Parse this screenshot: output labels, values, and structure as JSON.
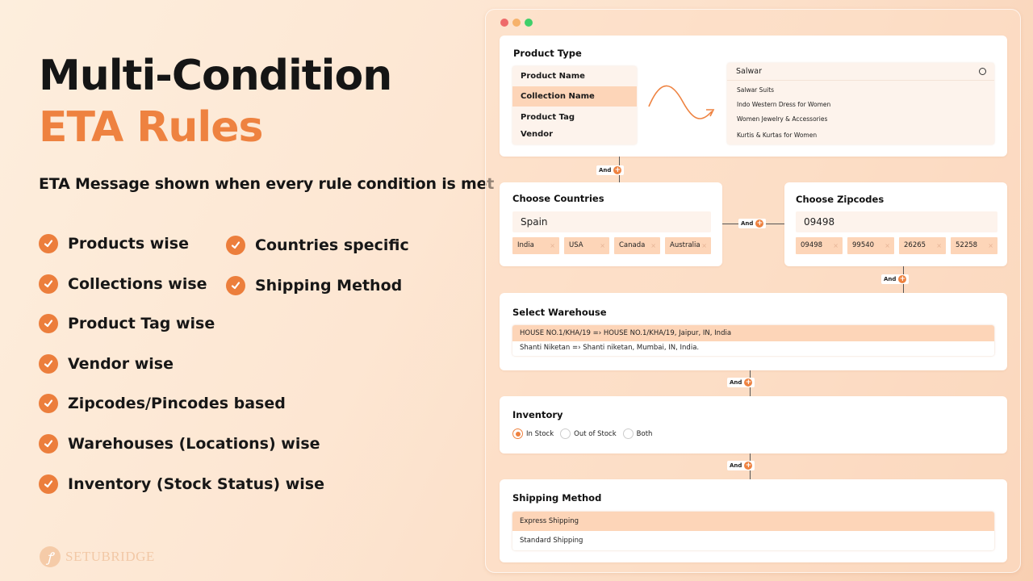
{
  "hero": {
    "title_line1": "Multi-Condition",
    "title_line2": "ETA Rules",
    "subtitle": "ETA Message shown when every rule condition is met",
    "features": [
      "Products wise",
      "Collections wise",
      "Product Tag wise",
      "Vendor wise",
      "Zipcodes/Pincodes based",
      "Warehouses (Locations) wise",
      "Inventory (Stock Status) wise",
      "Countries specific",
      "Shipping Method"
    ],
    "feature_icon": "check-circle-icon",
    "brand": "SETUBRIDGE"
  },
  "colors": {
    "accent": "#ee8240",
    "chip_bg": "#fdd5b8",
    "field_bg": "#fdf3ec"
  },
  "window": {
    "traffic_lights": [
      "#ee6a6a",
      "#f6b26b",
      "#3fcf6a"
    ],
    "connector_label": "And",
    "product_type": {
      "title": "Product Type",
      "options": [
        "Product Name",
        "Collection Name",
        "Product Tag",
        "Vendor"
      ],
      "selected": "Collection Name",
      "search_value": "Salwar",
      "suggestions": [
        "Salwar Suits",
        "Indo Western Dress for Women",
        "Women Jewelry & Accessories",
        "Kurtis & Kurtas for Women"
      ]
    },
    "countries": {
      "title": "Choose Countries",
      "input_value": "Spain",
      "chips": [
        "India",
        "USA",
        "Canada",
        "Australia"
      ]
    },
    "zipcodes": {
      "title": "Choose Zipcodes",
      "input_value": "09498",
      "chips": [
        "09498",
        "99540",
        "26265",
        "52258"
      ]
    },
    "warehouse": {
      "title": "Select Warehouse",
      "options": [
        "HOUSE NO.1/KHA/19 =› HOUSE NO.1/KHA/19, Jaipur, IN, India",
        "Shanti Niketan =› Shanti niketan, Mumbai, IN, India."
      ],
      "selected_index": 0
    },
    "inventory": {
      "title": "Inventory",
      "options": [
        "In Stock",
        "Out of Stock",
        "Both"
      ],
      "selected": "In Stock"
    },
    "shipping": {
      "title": "Shipping Method",
      "options": [
        "Express Shipping",
        "Standard Shipping"
      ],
      "selected_index": 0
    }
  }
}
